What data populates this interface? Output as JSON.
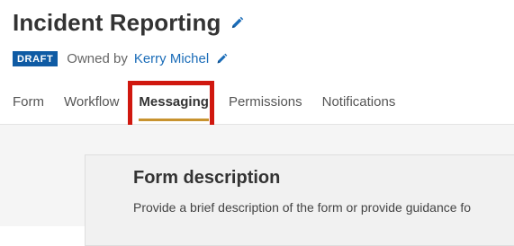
{
  "header": {
    "title": "Incident Reporting",
    "status_badge": "DRAFT",
    "owned_by_label": "Owned by",
    "owner_name": "Kerry Michel"
  },
  "tabs": [
    {
      "label": "Form",
      "active": false
    },
    {
      "label": "Workflow",
      "active": false
    },
    {
      "label": "Messaging",
      "active": true
    },
    {
      "label": "Permissions",
      "active": false
    },
    {
      "label": "Notifications",
      "active": false
    }
  ],
  "section": {
    "title": "Form description",
    "description": "Provide a brief description of the form or provide guidance fo"
  },
  "icons": {
    "title_edit": "pencil-icon",
    "owner_edit": "pencil-icon"
  },
  "colors": {
    "badge": "#0f5ba4",
    "link": "#1a6cb8",
    "active_tab_underline": "#c8932f",
    "highlight": "#d0180f"
  }
}
